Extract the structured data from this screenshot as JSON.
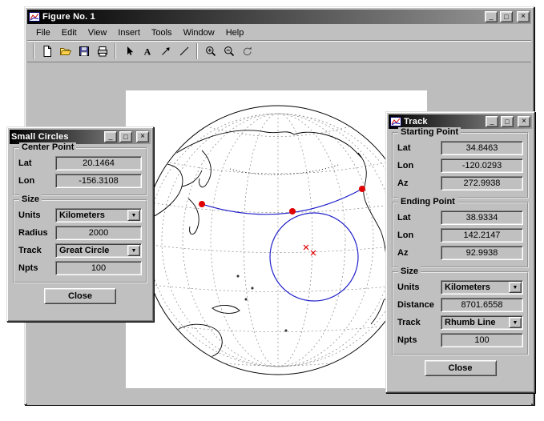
{
  "icons": {
    "minimize_glyph": "_",
    "maximize_glyph": "□",
    "close_glyph": "×",
    "dropdown_arrow": "▼"
  },
  "figure_window": {
    "title": "Figure No. 1",
    "menu": [
      "File",
      "Edit",
      "View",
      "Insert",
      "Tools",
      "Window",
      "Help"
    ],
    "toolbar": {
      "text_tool_label": "A"
    }
  },
  "map": {
    "colors": {
      "track": "#2222cc",
      "small_circle": "#2222cc",
      "marker": "#e00000",
      "coast": "#000000",
      "graticule": "#888888"
    }
  },
  "small_circles_dialog": {
    "title": "Small Circles",
    "center_point": {
      "legend": "Center Point",
      "lat_label": "Lat",
      "lat_value": "20.1464",
      "lon_label": "Lon",
      "lon_value": "-156.3108"
    },
    "size": {
      "legend": "Size",
      "units_label": "Units",
      "units_value": "Kilometers",
      "radius_label": "Radius",
      "radius_value": "2000",
      "track_label": "Track",
      "track_value": "Great Circle",
      "npts_label": "Npts",
      "npts_value": "100"
    },
    "close_label": "Close"
  },
  "track_dialog": {
    "title": "Track",
    "starting_point": {
      "legend": "Starting Point",
      "lat_label": "Lat",
      "lat_value": "34.8463",
      "lon_label": "Lon",
      "lon_value": "-120.0293",
      "az_label": "Az",
      "az_value": "272.9938"
    },
    "ending_point": {
      "legend": "Ending Point",
      "lat_label": "Lat",
      "lat_value": "38.9334",
      "lon_label": "Lon",
      "lon_value": "142.2147",
      "az_label": "Az",
      "az_value": "92.9938"
    },
    "size": {
      "legend": "Size",
      "units_label": "Units",
      "units_value": "Kilometers",
      "distance_label": "Distance",
      "distance_value": "8701.6558",
      "track_label": "Track",
      "track_value": "Rhumb Line",
      "npts_label": "Npts",
      "npts_value": "100"
    },
    "close_label": "Close"
  }
}
